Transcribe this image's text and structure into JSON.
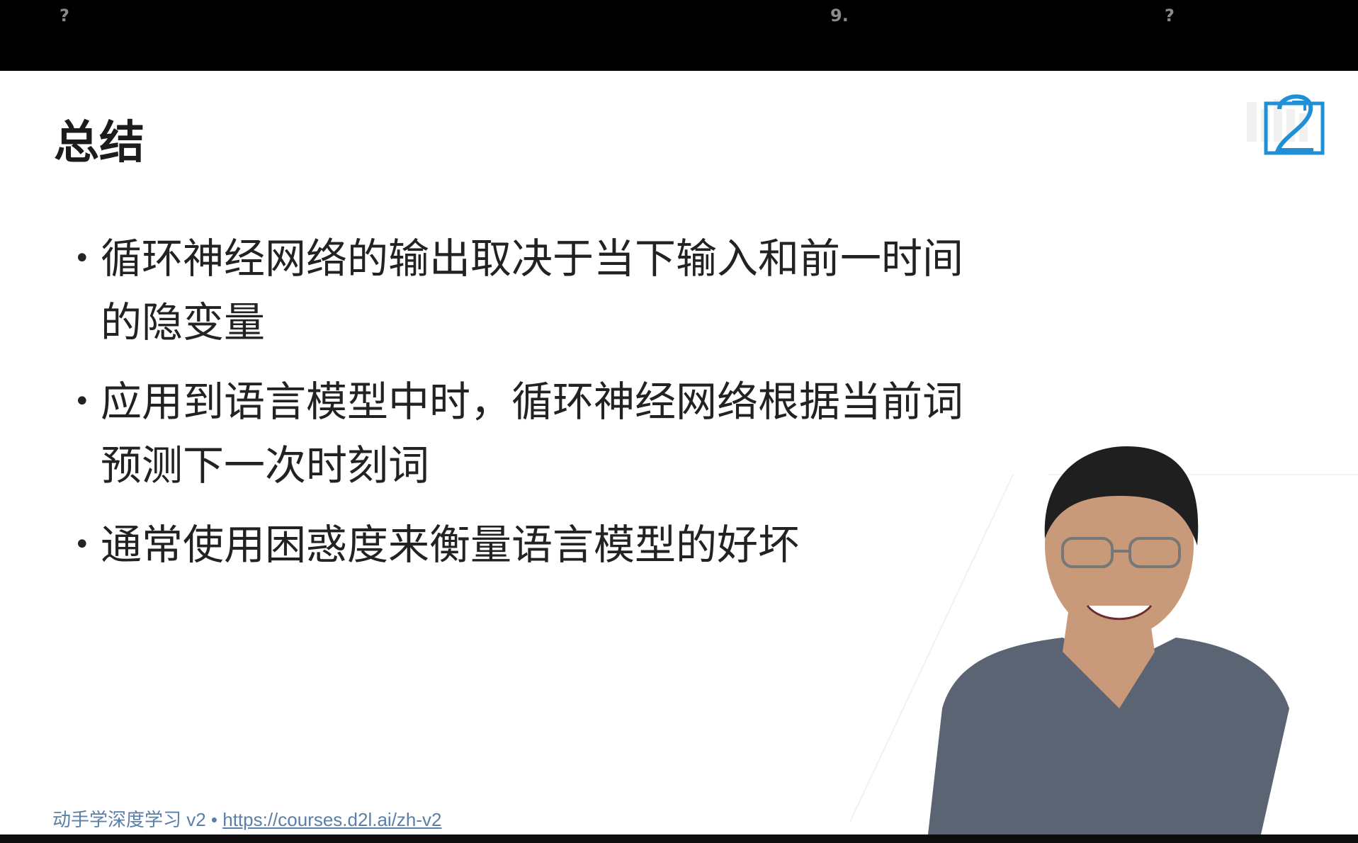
{
  "topbar": {
    "left": "?",
    "center": "9.",
    "right": "?"
  },
  "slide": {
    "title": "总结",
    "bullets": [
      "循环神经网络的输出取决于当下输入和前一时间的隐变量",
      "应用到语言模型中时，循环神经网络根据当前词预测下一次时刻词",
      "通常使用困惑度来衡量语言模型的好坏"
    ],
    "footer_text": "动手学深度学习 v2 • ",
    "footer_link": "https://courses.d2l.ai/zh-v2"
  },
  "logo": {
    "name": "d2l-logo",
    "color": "#1f8fd6"
  },
  "watermark": {
    "name": "bilibili-watermark"
  },
  "presenter": {
    "shirt_color": "#5b6472",
    "skin_color": "#c99a7a"
  }
}
